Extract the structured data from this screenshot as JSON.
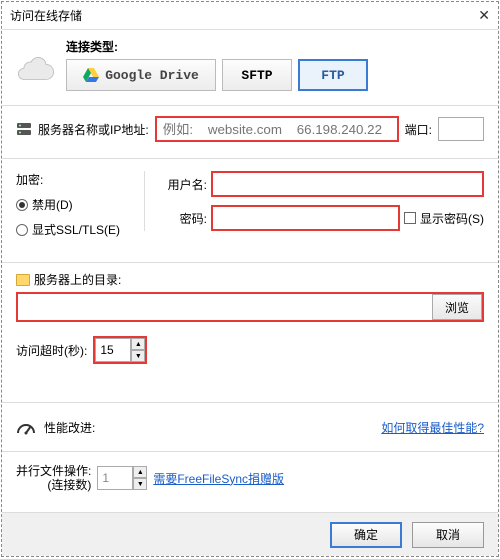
{
  "titlebar": {
    "title": "访问在线存储"
  },
  "connection": {
    "label": "连接类型:",
    "gdrive": "Google Drive",
    "sftp": "SFTP",
    "ftp": "FTP"
  },
  "server": {
    "label": "服务器名称或IP地址:",
    "placeholder": "例如:    website.com    66.198.240.22",
    "port_label": "端口:"
  },
  "encryption": {
    "title": "加密:",
    "disabled": "禁用(D)",
    "ssl": "显式SSL/TLS(E)"
  },
  "credentials": {
    "user_label": "用户名:",
    "pass_label": "密码:",
    "show_pass": "显示密码(S)"
  },
  "directory": {
    "label": "服务器上的目录:",
    "browse": "浏览"
  },
  "timeout": {
    "label": "访问超时(秒):",
    "value": "15"
  },
  "performance": {
    "label": "性能改进:",
    "help_link": "如何取得最佳性能?"
  },
  "parallel": {
    "label_line1": "并行文件操作:",
    "label_line2": "(连接数)",
    "value": "1",
    "donate_link": "需要FreeFileSync捐赠版"
  },
  "footer": {
    "ok": "确定",
    "cancel": "取消"
  }
}
